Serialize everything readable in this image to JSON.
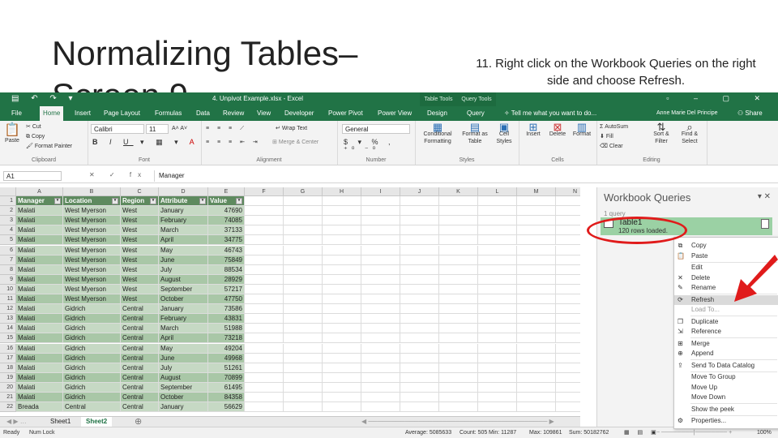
{
  "slide": {
    "title": "Normalizing Tables–\nScreen 9",
    "instruction": "11. Right click on the Workbook Queries on the right side and choose Refresh."
  },
  "excel": {
    "window_title": "4. Unpivot Example.xlsx - Excel",
    "context_groups": [
      "Table Tools",
      "Query Tools"
    ],
    "tabs": [
      "File",
      "Home",
      "Insert",
      "Page Layout",
      "Formulas",
      "Data",
      "Review",
      "View",
      "Developer",
      "Power Pivot",
      "Power View",
      "Design",
      "Query"
    ],
    "active_tab": "Home",
    "tell_me": "Tell me what you want to do...",
    "user": "Anne Marie Del Principe",
    "share": "Share",
    "ribbon": {
      "paste": "Paste",
      "cut": "Cut",
      "copy": "Copy",
      "format_painter": "Format Painter",
      "font_name": "Calibri",
      "font_size": "11",
      "wrap_text": "Wrap Text",
      "merge_center": "Merge & Center",
      "number_format": "General",
      "conditional_formatting": "Conditional Formatting",
      "format_as_table": "Format as Table",
      "cell_styles": "Cell Styles",
      "insert": "Insert",
      "delete": "Delete",
      "format": "Format",
      "autosum": "AutoSum",
      "fill": "Fill",
      "clear": "Clear",
      "sort_filter": "Sort & Filter",
      "find_select": "Find & Select",
      "groups": [
        "Clipboard",
        "Font",
        "Alignment",
        "Number",
        "Styles",
        "Cells",
        "Editing"
      ]
    },
    "name_box": "A1",
    "formula_value": "Manager",
    "columns": [
      "A",
      "B",
      "C",
      "D",
      "E",
      "F",
      "G",
      "H",
      "I",
      "J",
      "K",
      "L",
      "M",
      "N"
    ],
    "headers": [
      "Manager",
      "Location",
      "Region",
      "Attribute",
      "Value"
    ],
    "rows": [
      [
        "Malati",
        "West Myerson",
        "West",
        "January",
        "47690"
      ],
      [
        "Malati",
        "West Myerson",
        "West",
        "February",
        "74085"
      ],
      [
        "Malati",
        "West Myerson",
        "West",
        "March",
        "37133"
      ],
      [
        "Malati",
        "West Myerson",
        "West",
        "April",
        "34775"
      ],
      [
        "Malati",
        "West Myerson",
        "West",
        "May",
        "46743"
      ],
      [
        "Malati",
        "West Myerson",
        "West",
        "June",
        "75849"
      ],
      [
        "Malati",
        "West Myerson",
        "West",
        "July",
        "88534"
      ],
      [
        "Malati",
        "West Myerson",
        "West",
        "August",
        "28929"
      ],
      [
        "Malati",
        "West Myerson",
        "West",
        "September",
        "57217"
      ],
      [
        "Malati",
        "West Myerson",
        "West",
        "October",
        "47750"
      ],
      [
        "Malati",
        "Gidrich",
        "Central",
        "January",
        "73586"
      ],
      [
        "Malati",
        "Gidrich",
        "Central",
        "February",
        "43831"
      ],
      [
        "Malati",
        "Gidrich",
        "Central",
        "March",
        "51988"
      ],
      [
        "Malati",
        "Gidrich",
        "Central",
        "April",
        "73218"
      ],
      [
        "Malati",
        "Gidrich",
        "Central",
        "May",
        "49204"
      ],
      [
        "Malati",
        "Gidrich",
        "Central",
        "June",
        "49968"
      ],
      [
        "Malati",
        "Gidrich",
        "Central",
        "July",
        "51261"
      ],
      [
        "Malati",
        "Gidrich",
        "Central",
        "August",
        "70899"
      ],
      [
        "Malati",
        "Gidrich",
        "Central",
        "September",
        "61495"
      ],
      [
        "Malati",
        "Gidrich",
        "Central",
        "October",
        "84358"
      ],
      [
        "Breada",
        "Central",
        "Central",
        "January",
        "56629"
      ]
    ],
    "sheets": [
      "Sheet1",
      "Sheet2"
    ],
    "active_sheet": "Sheet2",
    "status": {
      "ready": "Ready",
      "num_lock": "Num Lock",
      "average": "Average: 5085633",
      "count": "Count: 505",
      "min": "Min: 11287",
      "max": "Max: 109861",
      "sum": "Sum: 50182762",
      "zoom": "100%"
    },
    "queries_pane": {
      "title": "Workbook Queries",
      "count": "1 query",
      "query_name": "Table1",
      "query_rows": "120 rows loaded."
    },
    "context_menu": [
      "Copy",
      "Paste",
      "Edit",
      "Delete",
      "Rename",
      "Refresh",
      "Load To...",
      "Duplicate",
      "Reference",
      "Merge",
      "Append",
      "Send To Data Catalog",
      "Move To Group",
      "Move Up",
      "Move Down",
      "Show the peek",
      "Properties..."
    ],
    "highlighted_item": "Refresh"
  },
  "colors": {
    "excel_green": "#217346",
    "annotation_red": "#e01b1b",
    "table_header": "#5e8a5f",
    "query_highlight": "#9bd1a4"
  },
  "icons": [
    "paste-icon",
    "cut-icon",
    "copy-icon",
    "format-painter-icon",
    "fx-icon",
    "close-icon",
    "table-icon",
    "refresh-icon",
    "red-arrow-icon"
  ]
}
